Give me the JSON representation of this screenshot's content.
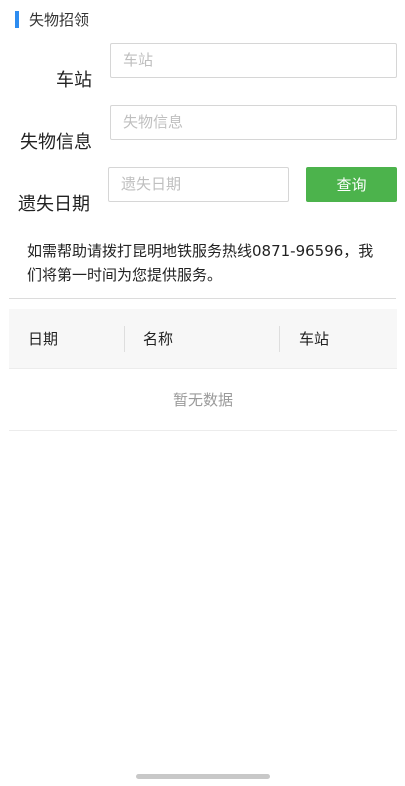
{
  "header": {
    "title": "失物招领"
  },
  "form": {
    "station": {
      "label": "车站",
      "placeholder": "车站",
      "value": ""
    },
    "item_name": {
      "label": "失物信息",
      "placeholder": "失物信息",
      "value": ""
    },
    "lost_date": {
      "label": "遗失日期",
      "placeholder": "遗失日期",
      "value": ""
    },
    "query_label": "查询"
  },
  "hint": "如需帮助请拨打昆明地铁服务热线0871-96596，我们将第一时间为您提供服务。",
  "table": {
    "columns": [
      "日期",
      "名称",
      "车站"
    ],
    "rows": [],
    "empty_text": "暂无数据"
  },
  "colors": {
    "accent": "#2d8cf0",
    "button": "#4cb34c"
  }
}
